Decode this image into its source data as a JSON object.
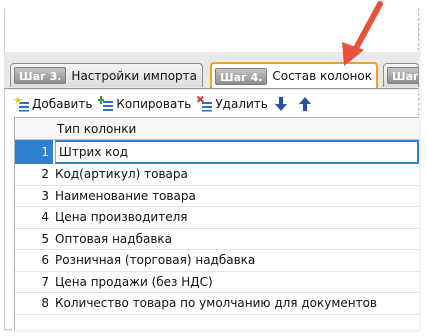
{
  "tabs": [
    {
      "step": "Шаг 3.",
      "label": "Настройки импорта",
      "active": false
    },
    {
      "step": "Шаг 4.",
      "label": "Состав колонок",
      "active": true
    },
    {
      "step": "Шаг",
      "label": "",
      "active": false
    }
  ],
  "toolbar": {
    "add_label": "Добавить",
    "copy_label": "Копировать",
    "delete_label": "Удалить",
    "move_down_icon": "arrow-down-icon",
    "move_up_icon": "arrow-up-icon"
  },
  "grid": {
    "header": "Тип колонки",
    "rows": [
      {
        "num": "1",
        "name": "Штрих код",
        "selected": true
      },
      {
        "num": "2",
        "name": "Код(артикул) товара"
      },
      {
        "num": "3",
        "name": "Наименование товара"
      },
      {
        "num": "4",
        "name": "Цена производителя"
      },
      {
        "num": "5",
        "name": "Оптовая надбавка"
      },
      {
        "num": "6",
        "name": "Розничная (торговая) надбавка"
      },
      {
        "num": "7",
        "name": "Цена продажи (без НДС)"
      },
      {
        "num": "8",
        "name": "Количество товара по умолчанию для документов"
      }
    ]
  },
  "colors": {
    "accent": "#2f80d0",
    "pointer": "#e8513a",
    "active_tab_border": "#f0a030"
  }
}
